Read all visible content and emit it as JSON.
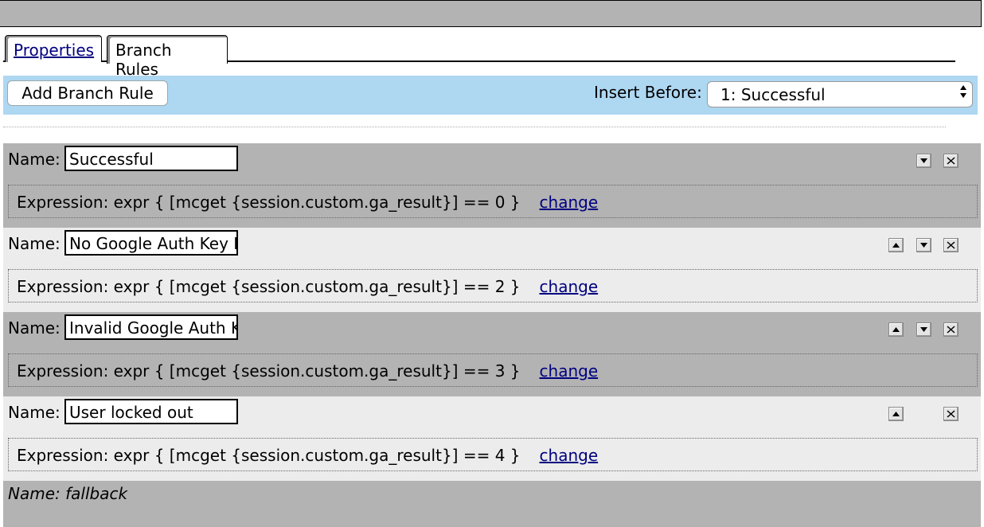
{
  "tabs": {
    "properties": "Properties",
    "branch_rules": "Branch Rules"
  },
  "toolbar": {
    "add_button": "Add Branch Rule",
    "insert_before_label": "Insert Before:",
    "insert_before_value": "1: Successful"
  },
  "rules": [
    {
      "name_label": "Name:",
      "name_value": "Successful",
      "expression": "Expression: expr { [mcget {session.custom.ga_result}] == 0 }",
      "change": "change"
    },
    {
      "name_label": "Name:",
      "name_value": "No Google Auth Key F",
      "expression": "Expression: expr { [mcget {session.custom.ga_result}] == 2 }",
      "change": "change"
    },
    {
      "name_label": "Name:",
      "name_value": "Invalid Google Auth K",
      "expression": "Expression: expr { [mcget {session.custom.ga_result}] == 3 }",
      "change": "change"
    },
    {
      "name_label": "Name:",
      "name_value": "User locked out",
      "expression": "Expression: expr { [mcget {session.custom.ga_result}] == 4 }",
      "change": "change"
    }
  ],
  "fallback": {
    "label": "Name: fallback"
  },
  "icons": {
    "move_up": "triangle-up-icon",
    "move_down": "triangle-down-icon",
    "delete": "close-x-icon"
  }
}
